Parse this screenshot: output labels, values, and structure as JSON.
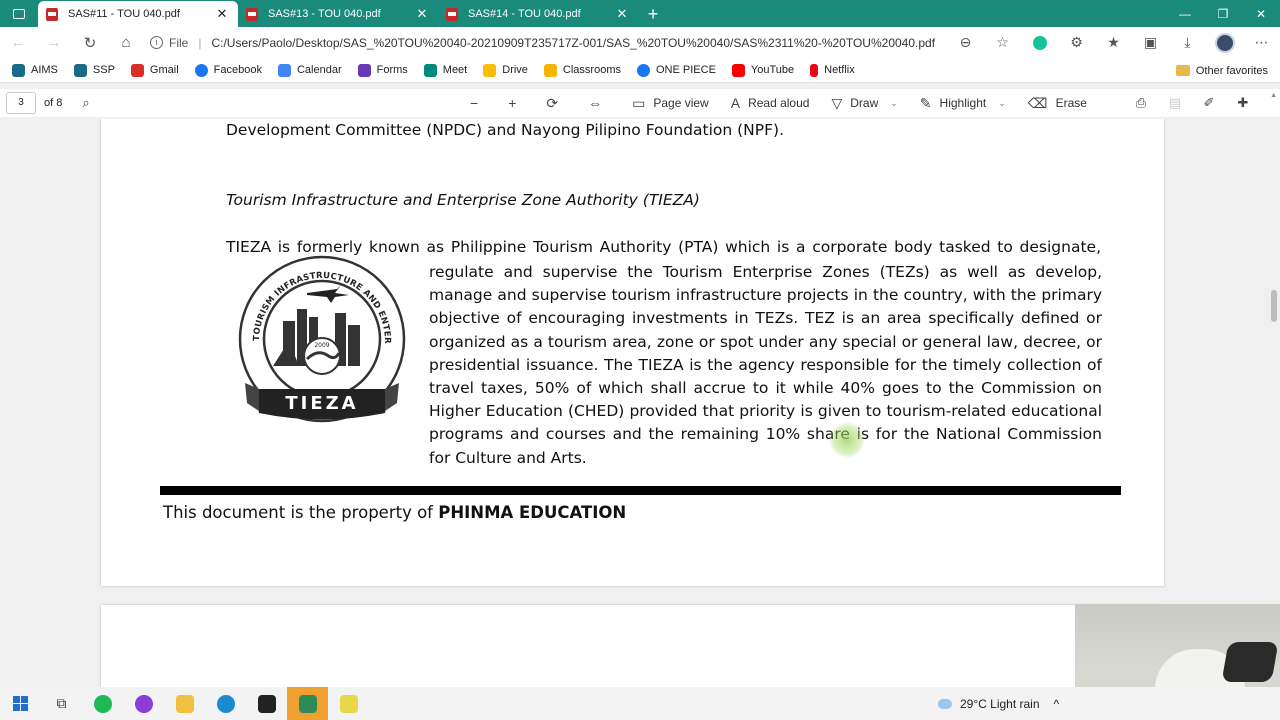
{
  "browser": {
    "tabs": [
      {
        "label": "SAS#11 - TOU 040.pdf",
        "active": true
      },
      {
        "label": "SAS#13 - TOU 040.pdf",
        "active": false
      },
      {
        "label": "SAS#14 - TOU 040.pdf",
        "active": false
      }
    ],
    "new_tab_glyph": "+",
    "address": {
      "scheme_label": "File",
      "url": "C:/Users/Paolo/Desktop/SAS_%20TOU%20040-20210909T235717Z-001/SAS_%20TOU%20040/SAS%2311%20-%20TOU%20040.pdf"
    },
    "bookmarks": [
      {
        "label": "AIMS",
        "color": "#1a6b8a"
      },
      {
        "label": "SSP",
        "color": "#1a6b8a"
      },
      {
        "label": "Gmail",
        "color": "#d93025"
      },
      {
        "label": "Facebook",
        "color": "#1877f2"
      },
      {
        "label": "Calendar",
        "color": "#4285f4"
      },
      {
        "label": "Forms",
        "color": "#673ab7"
      },
      {
        "label": "Meet",
        "color": "#00897b"
      },
      {
        "label": "Drive",
        "color": "#fbbc04"
      },
      {
        "label": "Classrooms",
        "color": "#f4b400"
      },
      {
        "label": "ONE PIECE",
        "color": "#1877f2"
      },
      {
        "label": "YouTube",
        "color": "#ff0000"
      },
      {
        "label": "Netflix",
        "color": "#e50914"
      }
    ],
    "other_favorites": "Other favorites"
  },
  "pdf_toolbar": {
    "page_number": "3",
    "page_count": "of 8",
    "page_view": "Page view",
    "read_aloud": "Read aloud",
    "draw": "Draw",
    "highlight": "Highlight",
    "erase": "Erase"
  },
  "document": {
    "line1": "Development Committee (NPDC) and Nayong Pilipino Foundation (NPF).",
    "heading": "Tourism Infrastructure and Enterprise Zone Authority (TIEZA)",
    "para_first": "TIEZA is formerly known as Philippine Tourism Authority (PTA) which is a corporate body tasked to designate,",
    "para_body": "regulate and supervise the Tourism Enterprise Zones (TEZs) as well as develop, manage and supervise tourism infrastructure projects in the country, with the primary objective of encouraging investments in TEZs. TEZ is an area specifically defined or organized as a tourism area, zone or spot under any special or general law, decree, or presidential issuance. The TIEZA is the agency responsible for the timely collection of travel taxes, 50% of which shall accrue to it while 40% goes to the Commission on Higher Education (CHED) provided that priority is given to tourism-related educational programs and courses and the remaining 10% share is for the National Commission for Culture and Arts.",
    "logo": {
      "ring_text": "TOURISM INFRASTRUCTURE AND ENTERPRISE ZONE AUTHORITY",
      "year": "2009",
      "banner": "TIEZA"
    },
    "footer_prefix": "This document is the property of ",
    "footer_bold": "PHINMA EDUCATION"
  },
  "taskbar": {
    "weather": "29°C  Light rain",
    "tray_caret": "^"
  }
}
